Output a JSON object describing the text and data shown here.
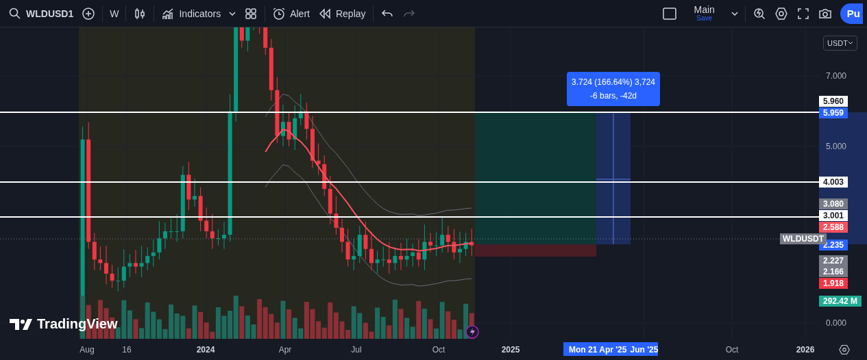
{
  "toolbar": {
    "symbol": "WLDUSD1",
    "interval": "W",
    "indicators_label": "Indicators",
    "alert_label": "Alert",
    "replay_label": "Replay",
    "redo_disabled": true,
    "layout_name": "Main",
    "layout_save": "Save",
    "publish_label": "Pu"
  },
  "chart": {
    "currency": "USDT",
    "price_ticks": [
      "7.000",
      "5.000",
      "0.000"
    ],
    "time_ticks": [
      {
        "label": "Aug",
        "bold": false
      },
      {
        "label": "16",
        "bold": false
      },
      {
        "label": "2024",
        "bold": true
      },
      {
        "label": "Apr",
        "bold": false
      },
      {
        "label": "Jul",
        "bold": false
      },
      {
        "label": "Oct",
        "bold": false
      },
      {
        "label": "2025",
        "bold": true
      },
      {
        "label": "Jun '25",
        "bold": true
      },
      {
        "label": "Oct",
        "bold": false
      },
      {
        "label": "2026",
        "bold": true
      }
    ],
    "crosshair_time": "Mon 21 Apr '25",
    "measure": {
      "line1": "3.724 (166.64%) 3,724",
      "line2": "-6 bars, -42d"
    },
    "symbol_label": "WLDUSDT",
    "price_tags": [
      {
        "value": "5.960",
        "color": "#ffffff"
      },
      {
        "value": "5.959",
        "color": "#2962ff"
      },
      {
        "value": "4.003",
        "color": "#ffffff"
      },
      {
        "value": "3.080",
        "color": "#787b86"
      },
      {
        "value": "3.001",
        "color": "#ffffff"
      },
      {
        "value": "2.588",
        "color": "#f7525f"
      },
      {
        "value": "2.235",
        "color": "#2962ff"
      },
      {
        "value": "2.227",
        "color": "#787b86"
      },
      {
        "value": "2.166",
        "color": "#787b86"
      },
      {
        "value": "1.918",
        "color": "#f23645"
      },
      {
        "value": "292.42 M",
        "color": "#22ab94"
      }
    ],
    "logo": "TradingView"
  }
}
